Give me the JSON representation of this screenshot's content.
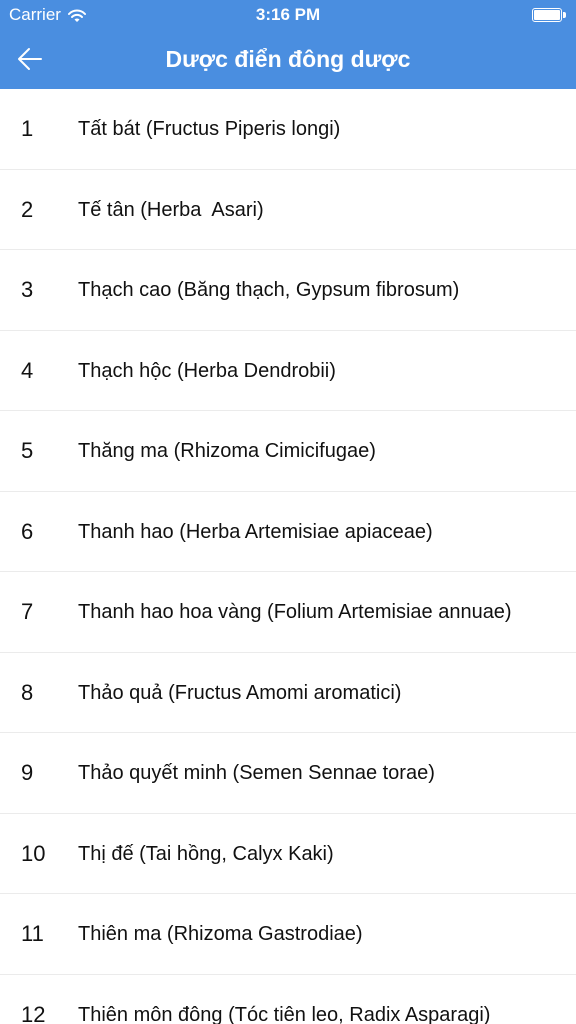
{
  "status_bar": {
    "carrier": "Carrier",
    "time": "3:16 PM",
    "wifi_icon": "wifi-icon",
    "battery_icon": "battery-icon"
  },
  "nav": {
    "title": "Dược điển đông dược",
    "back_icon": "arrow-left-icon",
    "background_color": "#4a8ee0"
  },
  "items": [
    {
      "index": "1",
      "name": "Tất bát (Fructus Piperis longi)"
    },
    {
      "index": "2",
      "name": "Tế tân (Herba  Asari)"
    },
    {
      "index": "3",
      "name": "Thạch cao (Băng thạch, Gypsum fibrosum)"
    },
    {
      "index": "4",
      "name": "Thạch hộc (Herba Dendrobii)"
    },
    {
      "index": "5",
      "name": "Thăng ma (Rhizoma Cimicifugae)"
    },
    {
      "index": "6",
      "name": "Thanh hao (Herba Artemisiae apiaceae)"
    },
    {
      "index": "7",
      "name": "Thanh hao hoa vàng (Folium Artemisiae annuae)"
    },
    {
      "index": "8",
      "name": "Thảo quả (Fructus Amomi aromatici)"
    },
    {
      "index": "9",
      "name": "Thảo quyết minh (Semen Sennae torae)"
    },
    {
      "index": "10",
      "name": "Thị đế (Tai hồng, Calyx Kaki)"
    },
    {
      "index": "11",
      "name": "Thiên ma (Rhizoma Gastrodiae)"
    },
    {
      "index": "12",
      "name": "Thiên môn đông (Tóc tiên leo, Radix Asparagi)"
    }
  ]
}
